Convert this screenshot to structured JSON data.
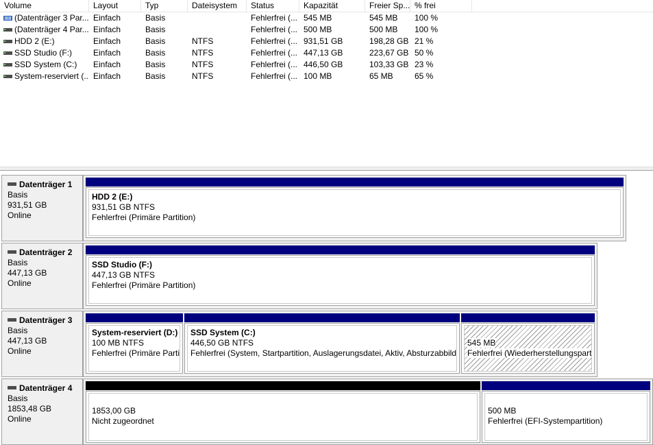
{
  "columns": [
    "Volume",
    "Layout",
    "Typ",
    "Dateisystem",
    "Status",
    "Kapazität",
    "Freier Sp...",
    "% frei"
  ],
  "volumes": [
    {
      "name": "(Datenträger 3 Par...",
      "layout": "Einfach",
      "typ": "Basis",
      "fs": "",
      "status": "Fehlerfrei (...",
      "kap": "545 MB",
      "frei": "545 MB",
      "pct": "100 %",
      "icon": "striped-volume-icon"
    },
    {
      "name": "(Datenträger 4 Par...",
      "layout": "Einfach",
      "typ": "Basis",
      "fs": "",
      "status": "Fehlerfrei (...",
      "kap": "500 MB",
      "frei": "500 MB",
      "pct": "100 %",
      "icon": "volume-icon"
    },
    {
      "name": "HDD 2 (E:)",
      "layout": "Einfach",
      "typ": "Basis",
      "fs": "NTFS",
      "status": "Fehlerfrei (...",
      "kap": "931,51 GB",
      "frei": "198,28 GB",
      "pct": "21 %",
      "icon": "volume-icon"
    },
    {
      "name": "SSD Studio (F:)",
      "layout": "Einfach",
      "typ": "Basis",
      "fs": "NTFS",
      "status": "Fehlerfrei (...",
      "kap": "447,13 GB",
      "frei": "223,67 GB",
      "pct": "50 %",
      "icon": "volume-icon"
    },
    {
      "name": "SSD System (C:)",
      "layout": "Einfach",
      "typ": "Basis",
      "fs": "NTFS",
      "status": "Fehlerfrei (...",
      "kap": "446,50 GB",
      "frei": "103,33 GB",
      "pct": "23 %",
      "icon": "volume-icon"
    },
    {
      "name": "System-reserviert (...",
      "layout": "Einfach",
      "typ": "Basis",
      "fs": "NTFS",
      "status": "Fehlerfrei (...",
      "kap": "100 MB",
      "frei": "65 MB",
      "pct": "65 %",
      "icon": "volume-icon"
    }
  ],
  "disks": [
    {
      "name": "Datenträger 1",
      "type": "Basis",
      "size": "931,51 GB",
      "state": "Online",
      "partitions": [
        {
          "title": "HDD 2  (E:)",
          "line1": "931,51 GB NTFS",
          "line2": "Fehlerfrei (Primäre Partition)",
          "style": "blue"
        }
      ]
    },
    {
      "name": "Datenträger 2",
      "type": "Basis",
      "size": "447,13 GB",
      "state": "Online",
      "partitions": [
        {
          "title": "SSD Studio  (F:)",
          "line1": "447,13 GB NTFS",
          "line2": "Fehlerfrei (Primäre Partition)",
          "style": "blue"
        }
      ]
    },
    {
      "name": "Datenträger 3",
      "type": "Basis",
      "size": "447,13 GB",
      "state": "Online",
      "partitions": [
        {
          "title": "System-reserviert  (D:)",
          "line1": "100 MB NTFS",
          "line2": "Fehlerfrei (Primäre Partit",
          "style": "blue"
        },
        {
          "title": "SSD System  (C:)",
          "line1": "446,50 GB NTFS",
          "line2": "Fehlerfrei (System, Startpartition, Auslagerungsdatei, Aktiv, Absturzabbild,",
          "style": "blue"
        },
        {
          "title": "",
          "line1": "545 MB",
          "line2": "Fehlerfrei (Wiederherstellungsparti",
          "style": "blue-hatched"
        }
      ]
    },
    {
      "name": "Datenträger 4",
      "type": "Basis",
      "size": "1853,48 GB",
      "state": "Online",
      "partitions": [
        {
          "title": "",
          "line1": "1853,00 GB",
          "line2": "Nicht zugeordnet",
          "style": "black"
        },
        {
          "title": "",
          "line1": "500 MB",
          "line2": "Fehlerfrei (EFI-Systempartition)",
          "style": "blue"
        }
      ]
    }
  ]
}
